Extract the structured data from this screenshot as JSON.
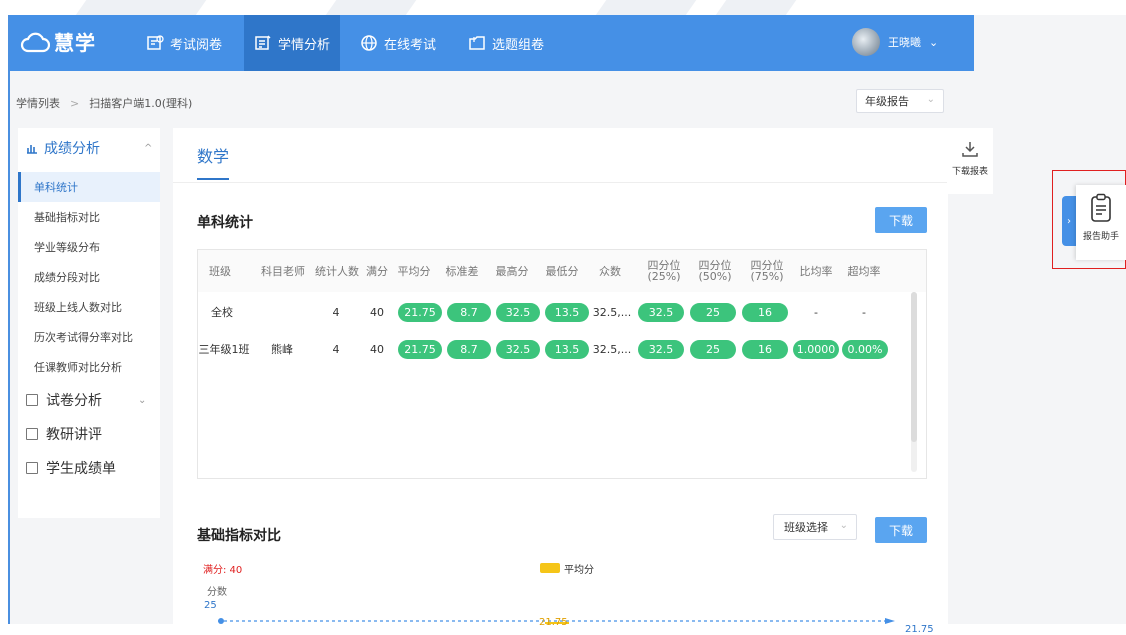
{
  "app": {
    "brand": "慧学"
  },
  "nav": [
    {
      "label": "考试阅卷",
      "icon": "exam-icon"
    },
    {
      "label": "学情分析",
      "icon": "analysis-icon",
      "active": true
    },
    {
      "label": "在线考试",
      "icon": "globe-icon"
    },
    {
      "label": "选题组卷",
      "icon": "folder-icon"
    }
  ],
  "user": {
    "name": "王晓曦",
    "caret": "⌄"
  },
  "breadcrumb": {
    "root": "学情列表",
    "sep": ">",
    "current": "扫描客户端1.0(理科)"
  },
  "report_select": {
    "value": "年级报告"
  },
  "sidebar": {
    "header": "成绩分析",
    "items": [
      {
        "label": "单科统计",
        "active": true
      },
      {
        "label": "基础指标对比"
      },
      {
        "label": "学业等级分布"
      },
      {
        "label": "成绩分段对比"
      },
      {
        "label": "班级上线人数对比"
      },
      {
        "label": "历次考试得分率对比"
      },
      {
        "label": "任课教师对比分析"
      }
    ],
    "groups": [
      {
        "label": "试卷分析",
        "has_caret": true
      },
      {
        "label": "教研讲评"
      },
      {
        "label": "学生成绩单"
      }
    ]
  },
  "main": {
    "subject": "数学",
    "section1": {
      "title": "单科统计",
      "download": "下载"
    },
    "table": {
      "headers": [
        "班级",
        "科目老师",
        "统计人数",
        "满分",
        "平均分",
        "标准差",
        "最高分",
        "最低分",
        "众数",
        "四分位\n(25%)",
        "四分位\n(50%)",
        "四分位\n(75%)",
        "比均率",
        "超均率"
      ],
      "rows": [
        {
          "cls": "全校",
          "teacher": "",
          "count": "4",
          "full": "40",
          "avg": "21.75",
          "std": "8.7",
          "max": "32.5",
          "min": "13.5",
          "mode": "32.5,...",
          "q25": "32.5",
          "q50": "25",
          "q75": "16",
          "ratio": "-",
          "over": "-"
        },
        {
          "cls": "三年级1班",
          "teacher": "熊峰",
          "count": "4",
          "full": "40",
          "avg": "21.75",
          "std": "8.7",
          "max": "32.5",
          "min": "13.5",
          "mode": "32.5,...",
          "q25": "32.5",
          "q50": "25",
          "q75": "16",
          "ratio": "1.0000",
          "over": "0.00%"
        }
      ]
    },
    "section2": {
      "title": "基础指标对比",
      "class_select": "班级选择",
      "download": "下载"
    },
    "chart": {
      "full_label": "满分: 40",
      "legend": "平均分",
      "y_axis_label": "分数",
      "y_top_tick": "25",
      "bar_value_label": "21.75",
      "line_value_label": "21.75"
    }
  },
  "right_panel": {
    "download_report": "下载报表",
    "assistant": "报告助手"
  },
  "colors": {
    "primary": "#4590e6",
    "active_nav": "#2f76c9",
    "pill_green": "#3cc47c",
    "legend_yellow": "#f5c518",
    "highlight_red": "#e02020"
  },
  "chart_data": {
    "type": "bar",
    "categories": [
      ""
    ],
    "series": [
      {
        "name": "平均分",
        "values": [
          21.75
        ]
      }
    ],
    "ylabel": "分数",
    "ylim": [
      0,
      25
    ],
    "annotations": [
      "满分: 40",
      "21.75"
    ]
  }
}
